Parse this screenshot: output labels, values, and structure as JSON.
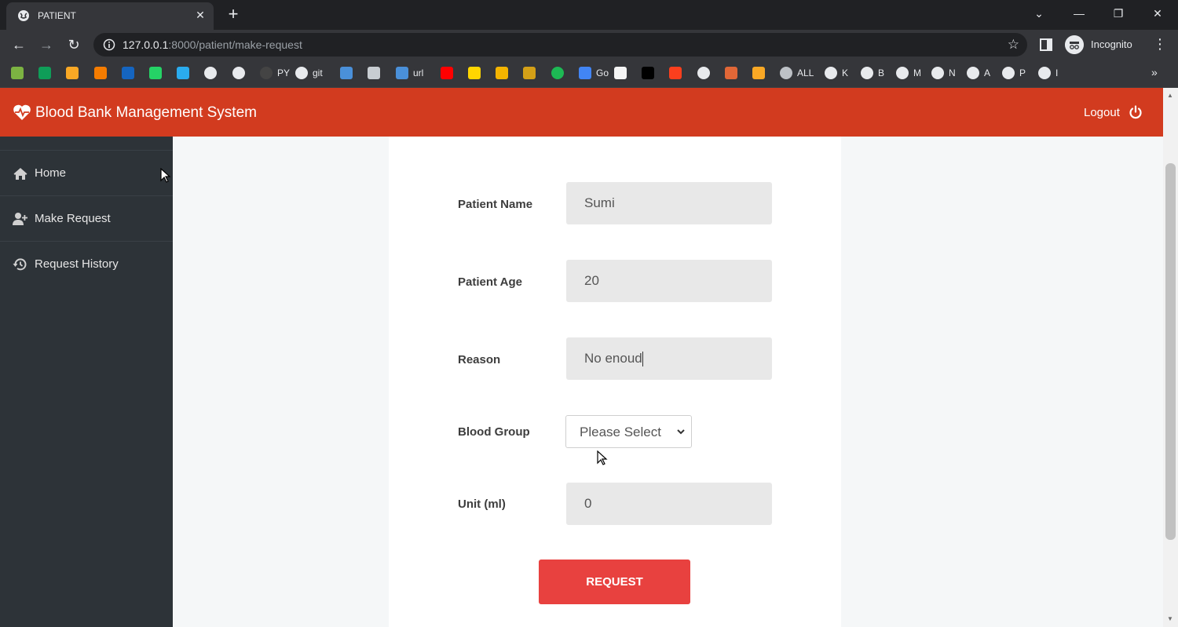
{
  "browser": {
    "tab_title": "PATIENT",
    "url_host": "127.0.0.1",
    "url_path": ":8000/patient/make-request",
    "profile_label": "Incognito",
    "bookmarks": [
      {
        "icon": "green-shape",
        "color": "#7cb342",
        "label": ""
      },
      {
        "icon": "green-plus",
        "color": "#0f9d58",
        "label": ""
      },
      {
        "icon": "orange-square",
        "color": "#f9a825",
        "label": ""
      },
      {
        "icon": "chart",
        "color": "#f57c00",
        "label": ""
      },
      {
        "icon": "ieee",
        "color": "#1565c0",
        "label": ""
      },
      {
        "icon": "whatsapp",
        "color": "#25d366",
        "label": ""
      },
      {
        "icon": "telegram",
        "color": "#2aabee",
        "label": ""
      },
      {
        "icon": "google",
        "color": "#e8eaed",
        "label": ""
      },
      {
        "icon": "google",
        "color": "#e8eaed",
        "label": ""
      },
      {
        "icon": "github",
        "color": "#444444",
        "label": "PY"
      },
      {
        "icon": "google",
        "color": "#e8eaed",
        "label": "git"
      },
      {
        "icon": "blue-doc",
        "color": "#4a90d9",
        "label": ""
      },
      {
        "icon": "drive",
        "color": "#c8cdd2",
        "label": ""
      },
      {
        "icon": "wifi",
        "color": "#4a90d9",
        "label": "url"
      },
      {
        "icon": "youtube",
        "color": "#ff0000",
        "label": ""
      },
      {
        "icon": "yellow-p",
        "color": "#ffd600",
        "label": ""
      },
      {
        "icon": "yellow-folder",
        "color": "#f4b400",
        "label": ""
      },
      {
        "icon": "orange-badge",
        "color": "#d4a017",
        "label": ""
      },
      {
        "icon": "green-ring",
        "color": "#1db954",
        "label": ""
      },
      {
        "icon": "swirl",
        "color": "#4285f4",
        "label": "Go"
      },
      {
        "icon": "white-doc",
        "color": "#f5f5f5",
        "label": ""
      },
      {
        "icon": "cl",
        "color": "#000000",
        "label": ""
      },
      {
        "icon": "yandex",
        "color": "#fc3f1d",
        "label": ""
      },
      {
        "icon": "google",
        "color": "#e8eaed",
        "label": ""
      },
      {
        "icon": "matlab",
        "color": "#e16737",
        "label": ""
      },
      {
        "icon": "eye",
        "color": "#f9a825",
        "label": ""
      },
      {
        "icon": "globe",
        "color": "#bdc1c6",
        "label": "ALL"
      },
      {
        "icon": "google",
        "color": "#e8eaed",
        "label": "K"
      },
      {
        "icon": "google",
        "color": "#e8eaed",
        "label": "B"
      },
      {
        "icon": "google",
        "color": "#e8eaed",
        "label": "M"
      },
      {
        "icon": "google",
        "color": "#e8eaed",
        "label": "N"
      },
      {
        "icon": "google",
        "color": "#e8eaed",
        "label": "A"
      },
      {
        "icon": "google",
        "color": "#e8eaed",
        "label": "P"
      },
      {
        "icon": "google",
        "color": "#e8eaed",
        "label": "I"
      }
    ]
  },
  "app": {
    "brand": "Blood Bank Management System",
    "logout_label": "Logout",
    "accent_color": "#d23b1f",
    "sidebar": {
      "items": [
        {
          "label": "Home",
          "icon": "home-icon"
        },
        {
          "label": "Make Request",
          "icon": "user-plus-icon"
        },
        {
          "label": "Request History",
          "icon": "history-icon"
        }
      ]
    },
    "form": {
      "patient_name_label": "Patient Name",
      "patient_name_value": "Sumi",
      "patient_age_label": "Patient Age",
      "patient_age_value": "20",
      "reason_label": "Reason",
      "reason_value": "No enoud",
      "blood_group_label": "Blood Group",
      "blood_group_selected": "Please Select",
      "unit_label": "Unit (ml)",
      "unit_value": "0",
      "submit_label": "REQUEST"
    }
  }
}
